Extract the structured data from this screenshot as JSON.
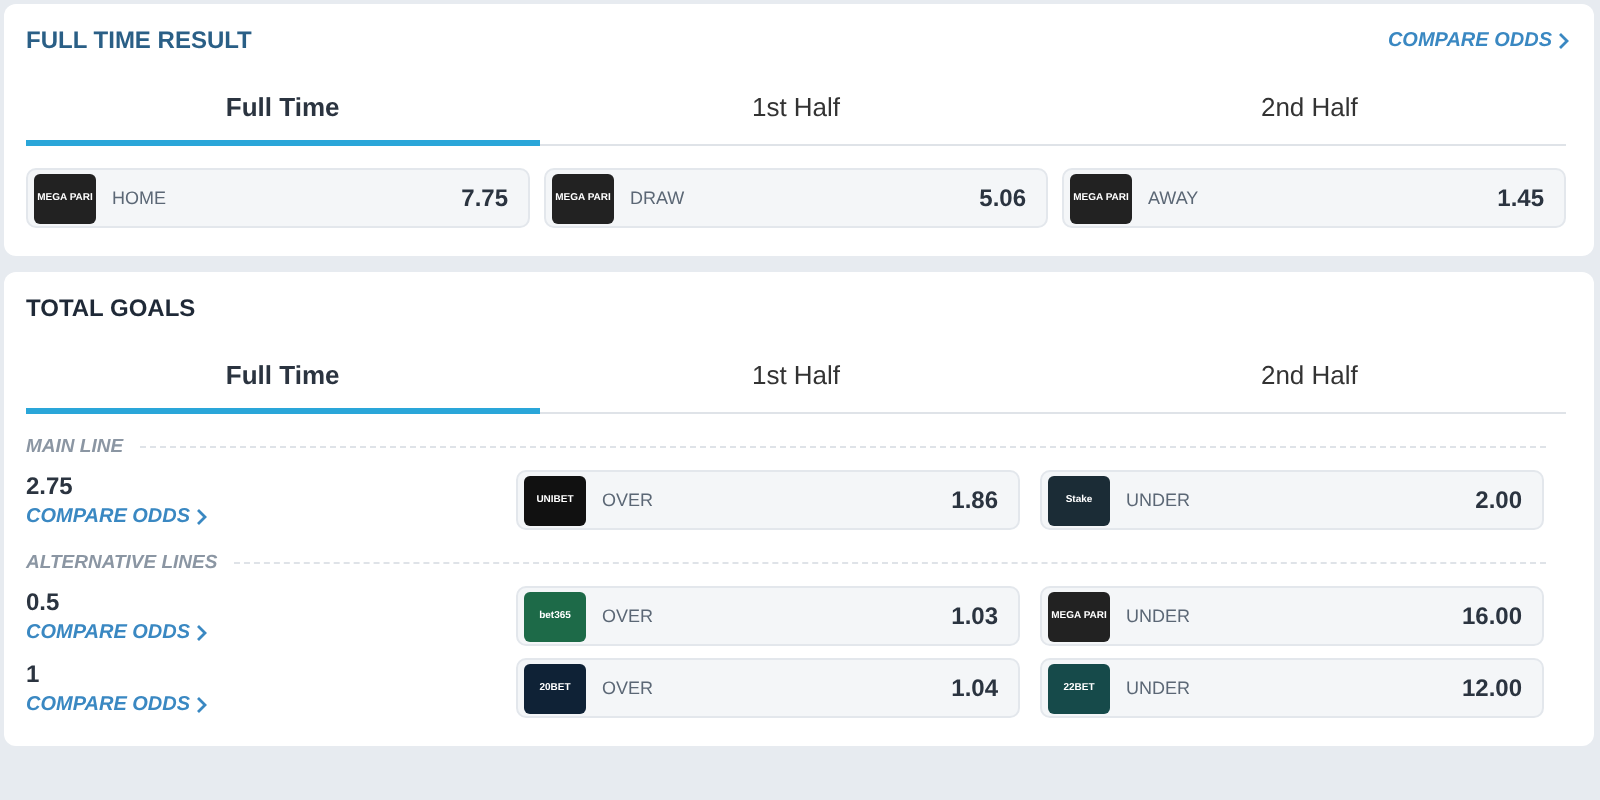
{
  "markets": [
    {
      "kind": "simple",
      "title": "FULL TIME RESULT",
      "compare_odds": "COMPARE ODDS",
      "tabs": [
        {
          "label": "Full Time",
          "selected": true
        },
        {
          "label": "1st Half",
          "selected": false
        },
        {
          "label": "2nd Half",
          "selected": false
        }
      ],
      "odds": [
        {
          "logo": "MEGA PARI",
          "color": "#222222",
          "label": "HOME",
          "price": "7.75"
        },
        {
          "logo": "MEGA PARI",
          "color": "#222222",
          "label": "DRAW",
          "price": "5.06"
        },
        {
          "logo": "MEGA PARI",
          "color": "#222222",
          "label": "AWAY",
          "price": "1.45"
        }
      ]
    },
    {
      "kind": "lines",
      "title": "TOTAL GOALS",
      "tabs": [
        {
          "label": "Full Time",
          "selected": true
        },
        {
          "label": "1st Half",
          "selected": false
        },
        {
          "label": "2nd Half",
          "selected": false
        }
      ],
      "groups": [
        {
          "label": "MAIN LINE",
          "lines": [
            {
              "value": "2.75",
              "compare_odds": "COMPARE ODDS",
              "odds": [
                {
                  "logo": "UNIBET",
                  "color": "#111111",
                  "label": "OVER",
                  "price": "1.86"
                },
                {
                  "logo": "Stake",
                  "color": "#1b2c36",
                  "label": "UNDER",
                  "price": "2.00"
                }
              ]
            }
          ]
        },
        {
          "label": "ALTERNATIVE LINES",
          "lines": [
            {
              "value": "0.5",
              "compare_odds": "COMPARE ODDS",
              "odds": [
                {
                  "logo": "bet365",
                  "color": "#1d6a48",
                  "label": "OVER",
                  "price": "1.03"
                },
                {
                  "logo": "MEGA PARI",
                  "color": "#222222",
                  "label": "UNDER",
                  "price": "16.00"
                }
              ]
            },
            {
              "value": "1",
              "compare_odds": "COMPARE ODDS",
              "odds": [
                {
                  "logo": "20BET",
                  "color": "#0f2236",
                  "label": "OVER",
                  "price": "1.04"
                },
                {
                  "logo": "22BET",
                  "color": "#164a4a",
                  "label": "UNDER",
                  "price": "12.00"
                }
              ]
            }
          ]
        }
      ]
    }
  ]
}
